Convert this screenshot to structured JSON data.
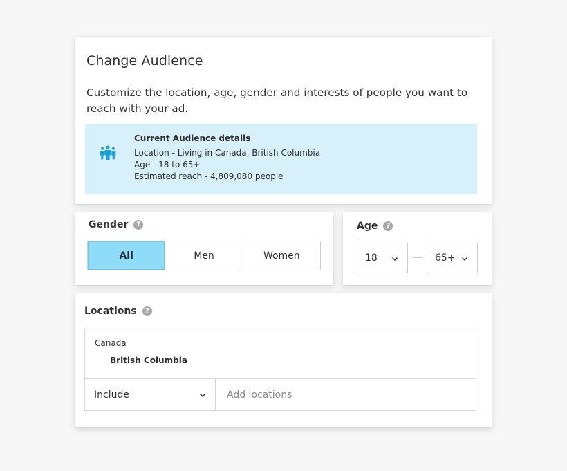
{
  "audience": {
    "title": "Change Audience",
    "description": "Customize the location, age, gender and interests of people you want to reach with your ad.",
    "details": {
      "heading": "Current Audience details",
      "location": "Location - Living in Canada, British Columbia",
      "age": "Age - 18 to 65+",
      "reach": "Estimated reach - 4,809,080 people",
      "icon": "people-group-icon"
    }
  },
  "gender": {
    "label": "Gender",
    "options": [
      "All",
      "Men",
      "Women"
    ],
    "selected": "All"
  },
  "age": {
    "label": "Age",
    "min": "18",
    "max": "65+"
  },
  "locations": {
    "label": "Locations",
    "country": "Canada",
    "region": "British Columbia",
    "mode": "Include",
    "add_placeholder": "Add locations"
  },
  "colors": {
    "info_bg": "#d7f0f9",
    "accent": "#8fdcf9",
    "icon_blue": "#1a9fd8",
    "help_gray": "#a9a9a9"
  }
}
